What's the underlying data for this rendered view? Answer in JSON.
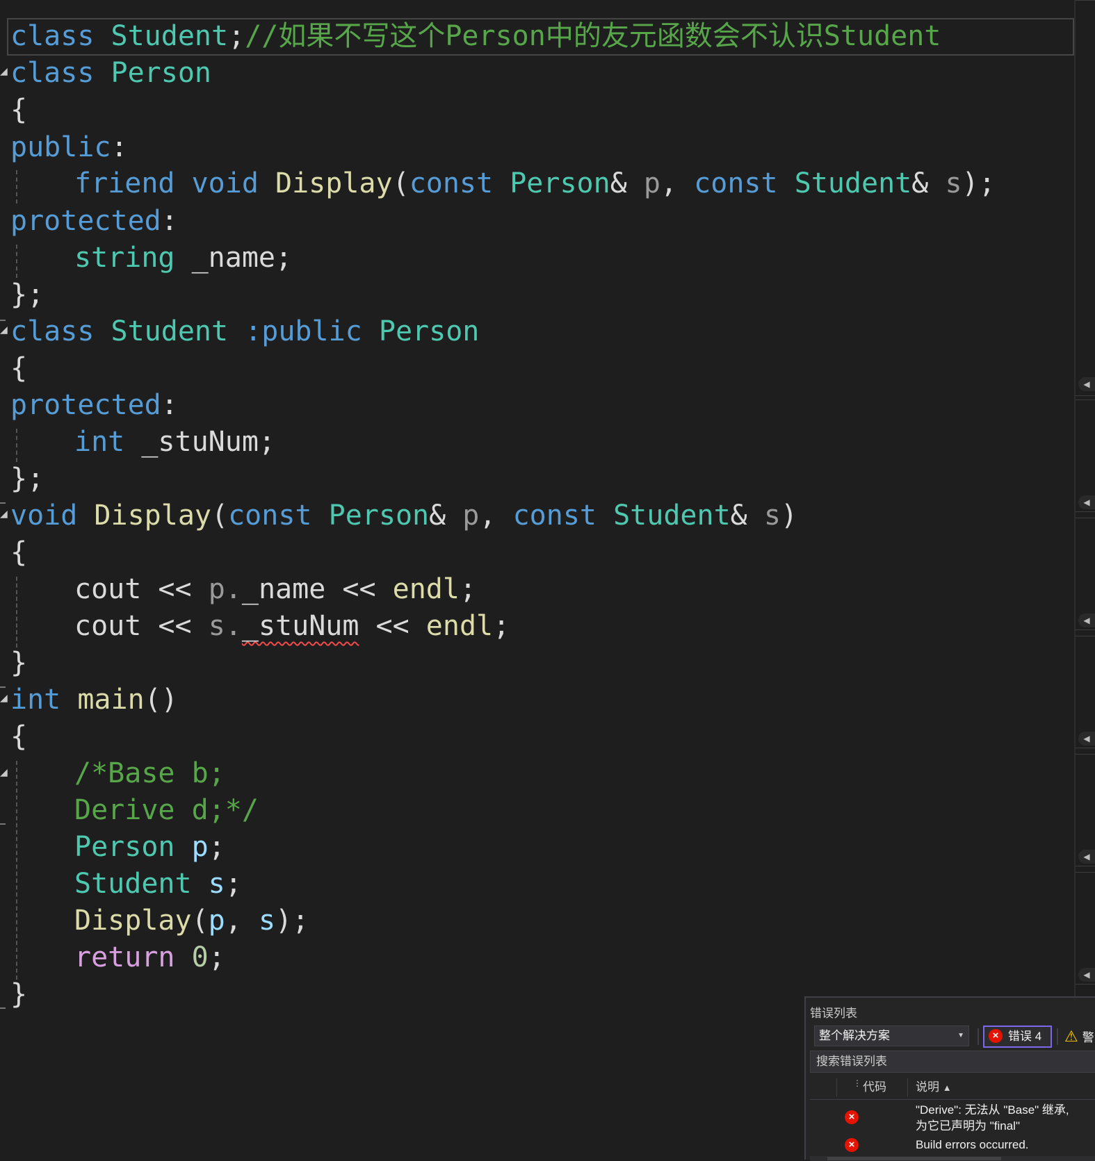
{
  "editor": {
    "line1": {
      "kw": "class",
      "type": "Student",
      "punct": ";",
      "comment": "//如果不写这个Person中的友元函数会不认识Student"
    },
    "line2": {
      "kw": "class",
      "type": "Person"
    },
    "brace_open": "{",
    "brace_close": "}",
    "brace_close_semi": "};",
    "access_public": "public",
    "access_protected": "protected",
    "colon": ":",
    "line5": {
      "kw_friend": "friend",
      "kw_void": "void",
      "fn": "Display",
      "open": "(",
      "kw_const1": "const",
      "type_person": "Person",
      "amp1": "&",
      "param_p": "p",
      "comma": ",",
      "kw_const2": "const",
      "type_student": "Student",
      "amp2": "&",
      "param_s": "s",
      "close": ");"
    },
    "line7": {
      "type": "string",
      "member": "_name",
      "semi": ";"
    },
    "line9": {
      "kw": "class",
      "type": "Student",
      "colon_kw": ":public",
      "base": "Person"
    },
    "line12": {
      "kw": "int",
      "member": "_stuNum",
      "semi": ";"
    },
    "line14": {
      "kw_void": "void",
      "fn": "Display",
      "open": "(",
      "kw_const1": "const",
      "type_person": "Person",
      "amp1": "&",
      "param_p": "p",
      "comma": ",",
      "kw_const2": "const",
      "type_student": "Student",
      "amp2": "&",
      "param_s": "s",
      "close": ")"
    },
    "line16": {
      "fn": "cout",
      "op1": "<<",
      "obj": "p.",
      "member": "_name",
      "op2": "<<",
      "endl": "endl",
      "semi": ";"
    },
    "line17": {
      "fn": "cout",
      "op1": "<<",
      "obj": "s.",
      "member": "_stuNum",
      "op2": "<<",
      "endl": "endl",
      "semi": ";"
    },
    "line19": {
      "kw": "int",
      "fn": "main",
      "parens": "()"
    },
    "line21": {
      "comment": "/*Base b;"
    },
    "line22": {
      "comment": "Derive d;*/"
    },
    "line23": {
      "type": "Person",
      "var": "p",
      "semi": ";"
    },
    "line24": {
      "type": "Student",
      "var": "s",
      "semi": ";"
    },
    "line25": {
      "fn": "Display",
      "open": "(",
      "arg1": "p",
      "comma": ",",
      "arg2": "s",
      "close": ");"
    },
    "line26": {
      "kw": "return",
      "num": "0",
      "semi": ";"
    }
  },
  "error_panel": {
    "title": "错误列表",
    "scope_select": "整个解决方案",
    "errors_button": "错误 4",
    "warnings_button_partial": "警",
    "search_placeholder": "搜索错误列表",
    "columns": {
      "code": "代码",
      "description": "说明"
    },
    "rows": [
      {
        "line1": "\"Derive\": 无法从 \"Base\" 继承,",
        "line2": "为它已声明为 \"final\""
      },
      {
        "line1": "Build errors occurred."
      }
    ]
  },
  "colors": {
    "background": "#1e1e1e",
    "keyword": "#569cd6",
    "type": "#4ec9b0",
    "function": "#dcdcaa",
    "comment": "#57a64a",
    "parameter": "#9a9a9a",
    "local": "#9cdcfe",
    "control": "#d8a0df",
    "error": "#e51400"
  }
}
